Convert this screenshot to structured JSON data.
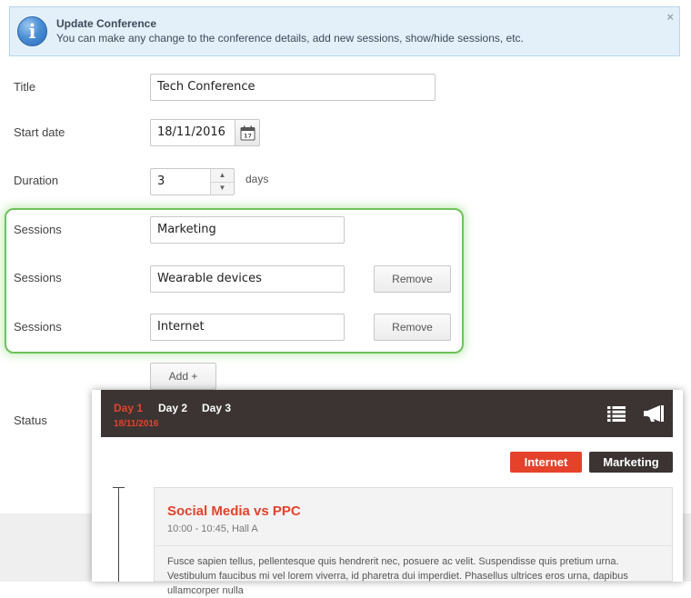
{
  "banner": {
    "title": "Update Conference",
    "text": "You can make any change to the conference details, add new sessions, show/hide sessions, etc.",
    "close": "×"
  },
  "form": {
    "title_label": "Title",
    "title_value": "Tech Conference",
    "start_date_label": "Start date",
    "start_date_value": "18/11/2016",
    "duration_label": "Duration",
    "duration_value": "3",
    "duration_unit": "days",
    "sessions": [
      {
        "label": "Sessions",
        "value": "Marketing"
      },
      {
        "label": "Sessions",
        "value": "Wearable devices",
        "remove_label": "Remove"
      },
      {
        "label": "Sessions",
        "value": "Internet",
        "remove_label": "Remove"
      }
    ],
    "add_label": "Add +",
    "status_label": "Status"
  },
  "preview": {
    "tabs": [
      {
        "label": "Day 1",
        "active": true
      },
      {
        "label": "Day 2",
        "active": false
      },
      {
        "label": "Day 3",
        "active": false
      }
    ],
    "active_date": "18/11/2016",
    "icons": [
      "list-icon",
      "megaphone-icon"
    ],
    "tags": [
      {
        "label": "Internet",
        "color": "#e5422b"
      },
      {
        "label": "Marketing",
        "color": "#3b3433"
      }
    ],
    "event": {
      "title": "Social Media vs PPC",
      "meta": "10:00 - 10:45, Hall A",
      "description": "Fusce sapien tellus, pellentesque quis hendrerit nec, posuere ac velit. Suspendisse quis pretium urna. Vestibulum faucibus mi vel lorem viverra, id pharetra dui imperdiet. Phasellus ultrices eros urna, dapibus ullamcorper nulla"
    }
  },
  "colors": {
    "accent": "#e5422b",
    "dark": "#3b3433",
    "highlight": "#6cc35a",
    "banner_bg": "#e3f0fa"
  }
}
